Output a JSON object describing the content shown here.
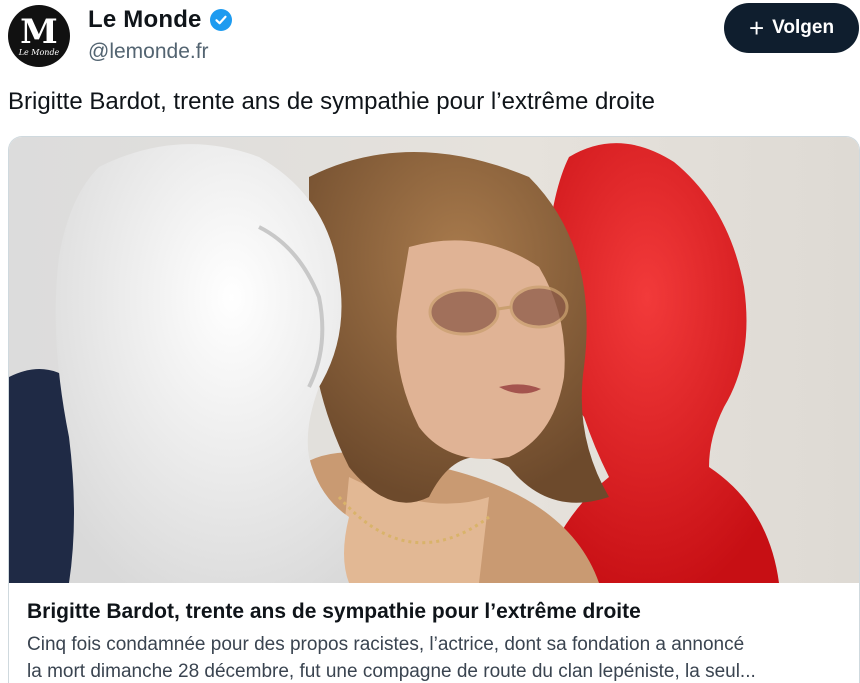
{
  "account": {
    "avatar_letter": "M",
    "avatar_wordmark": "Le Monde",
    "name": "Le Monde",
    "handle": "@lemonde.fr",
    "verified_icon": "verified-badge-icon",
    "verified_color": "#1d9bf0"
  },
  "follow_button": {
    "icon": "plus-icon",
    "plus_glyph": "+",
    "label": "Volgen",
    "background": "#0f1e2e"
  },
  "post": {
    "text": "Brigitte Bardot, trente ans de sympathie pour l’extrême droite"
  },
  "link_card": {
    "image_description_icon": "photo-image",
    "title": "Brigitte Bardot, trente ans de sympathie pour l’extrême droite",
    "description_line1": "Cinq fois condamnée pour des propos racistes, l’actrice, dont sa fondation a annoncé",
    "description_line2": "la mort dimanche 28 décembre, fut une compagne de route du clan lepéniste, la seul..."
  }
}
